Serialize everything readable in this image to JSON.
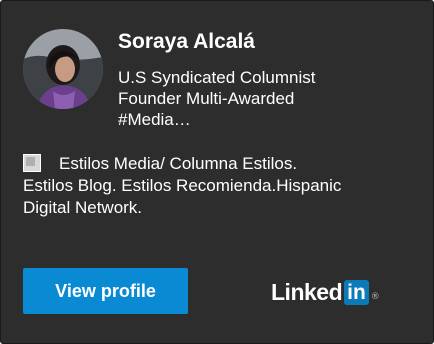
{
  "profile": {
    "name": "Soraya Alcalá",
    "headline_lines": [
      "U.S Syndicated Columnist",
      "Founder Multi-Awarded",
      "#Media…"
    ],
    "summary_lines": [
      "Estilos Media/ Columna Estilos.",
      "Estilos Blog. Estilos Recomienda.Hispanic",
      "Digital Network."
    ],
    "avatar_icon": "profile-photo"
  },
  "actions": {
    "view_profile_label": "View profile"
  },
  "brand": {
    "word": "Linked",
    "box": "in",
    "registered": "®",
    "box_color": "#0a7ab8"
  },
  "colors": {
    "card_background": "#2d2d2d",
    "button_background": "#0a8ad2"
  }
}
